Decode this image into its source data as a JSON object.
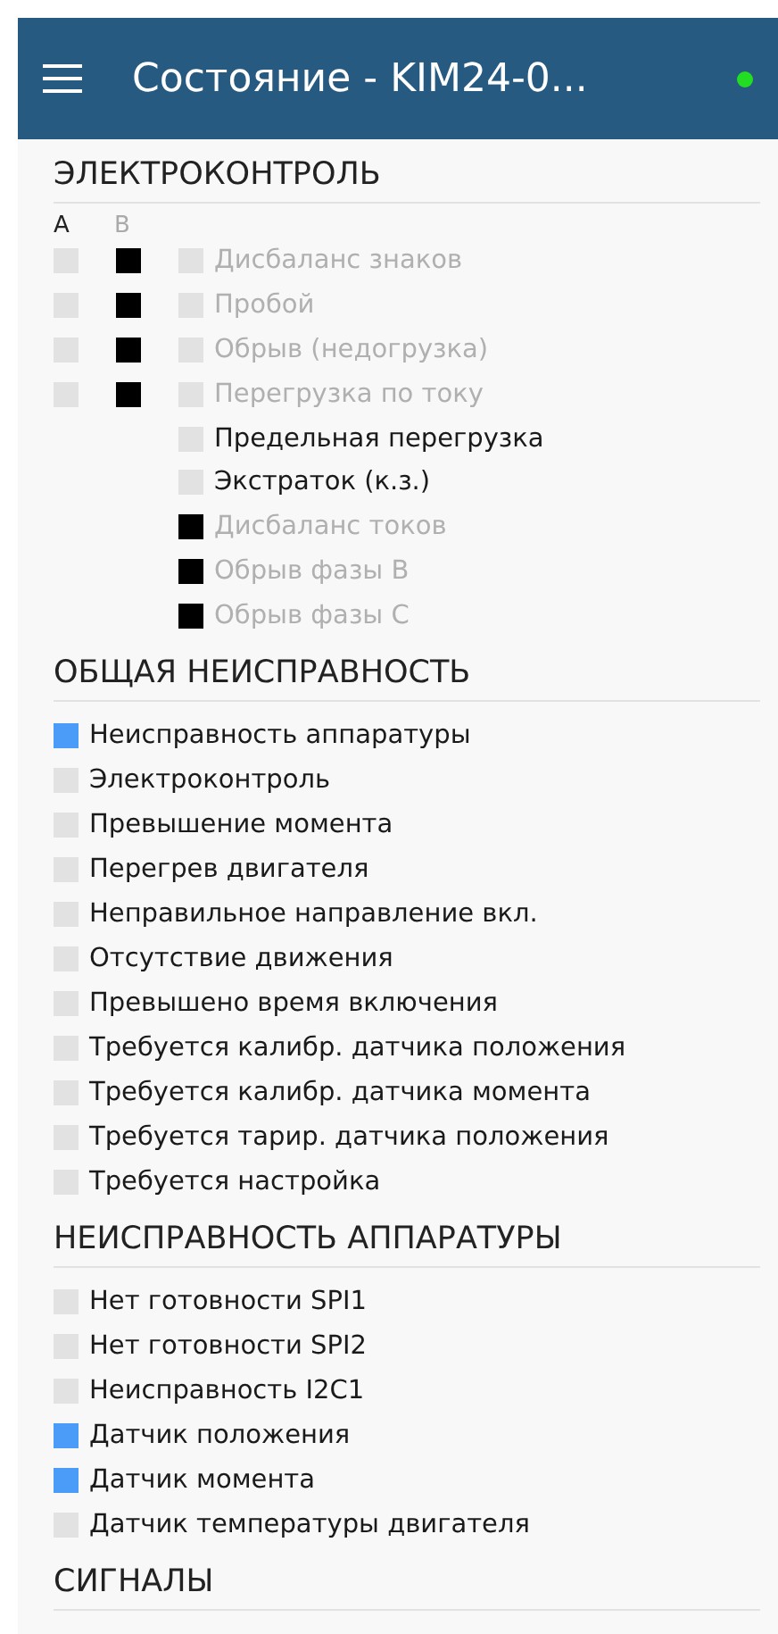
{
  "app_bar": {
    "title": "Состояние - KIM24-0...",
    "connected": true
  },
  "electrocontrol": {
    "title": "ЭЛЕКТРОКОНТРОЛЬ",
    "column_a": "А",
    "column_b": "В",
    "rows": [
      {
        "label": "Дисбаланс знаков",
        "a_active": false,
        "b_active": true,
        "active": false,
        "disabled": true
      },
      {
        "label": "Пробой",
        "a_active": false,
        "b_active": true,
        "active": false,
        "disabled": true
      },
      {
        "label": "Обрыв (недогрузка)",
        "a_active": false,
        "b_active": true,
        "active": false,
        "disabled": true
      },
      {
        "label": "Перегрузка по току",
        "a_active": false,
        "b_active": true,
        "active": false,
        "disabled": true
      },
      {
        "label": "Предельная перегрузка",
        "active": false,
        "disabled": false
      },
      {
        "label": "Экстраток (к.з.)",
        "active": false,
        "disabled": false
      },
      {
        "label": "Дисбаланс токов",
        "active": true,
        "disabled": true
      },
      {
        "label": "Обрыв фазы В",
        "active": true,
        "disabled": true
      },
      {
        "label": "Обрыв фазы С",
        "active": true,
        "disabled": true
      }
    ]
  },
  "sections": [
    {
      "title": "ОБЩАЯ НЕИСПРАВНОСТЬ",
      "items": [
        {
          "label": "Неисправность аппаратуры",
          "active": true
        },
        {
          "label": "Электроконтроль",
          "active": false
        },
        {
          "label": "Превышение момента",
          "active": false
        },
        {
          "label": "Перегрев двигателя",
          "active": false
        },
        {
          "label": "Неправильное направление вкл.",
          "active": false
        },
        {
          "label": "Отсутствие движения",
          "active": false
        },
        {
          "label": "Превышено время включения",
          "active": false
        },
        {
          "label": "Требуется калибр. датчика положения",
          "active": false
        },
        {
          "label": "Требуется калибр. датчика момента",
          "active": false
        },
        {
          "label": "Требуется тарир. датчика положения",
          "active": false
        },
        {
          "label": "Требуется настройка",
          "active": false
        }
      ]
    },
    {
      "title": "НЕИСПРАВНОСТЬ АППАРАТУРЫ",
      "items": [
        {
          "label": "Нет готовности SPI1",
          "active": false
        },
        {
          "label": "Нет готовности SPI2",
          "active": false
        },
        {
          "label": "Неисправность I2C1",
          "active": false
        },
        {
          "label": "Датчик положения",
          "active": true
        },
        {
          "label": "Датчик момента",
          "active": true
        },
        {
          "label": "Датчик температуры двигателя",
          "active": false
        }
      ]
    },
    {
      "title": "СИГНАЛЫ"
    }
  ]
}
